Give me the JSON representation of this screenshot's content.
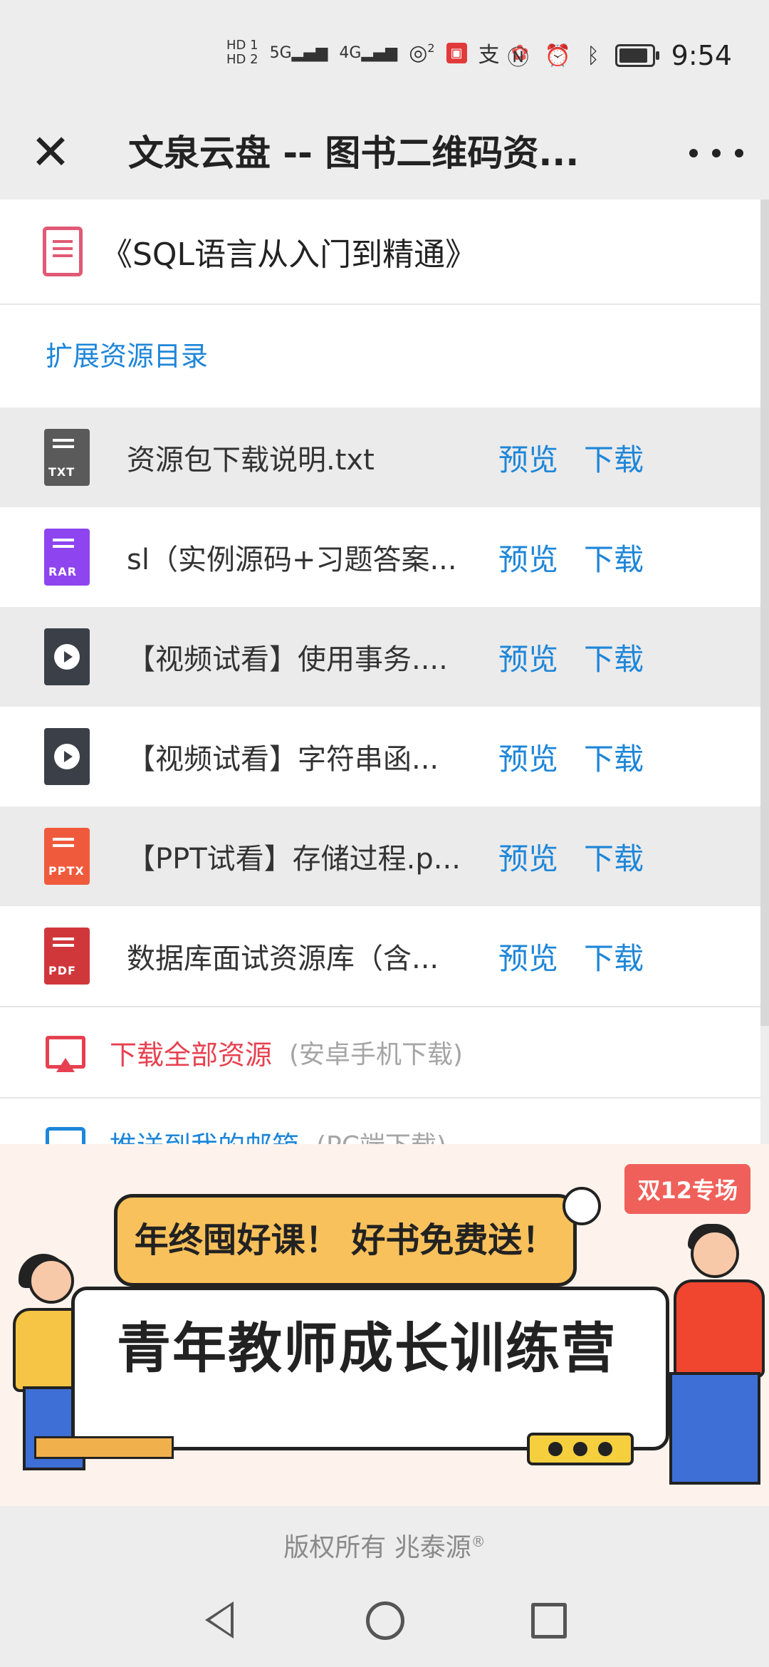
{
  "status_bar": {
    "sim1": "HD 1",
    "sim2": "HD 2",
    "net1": "5G",
    "net2": "4G",
    "wifi_sup": "2",
    "app_icon_zhi": "支",
    "time": "9:54"
  },
  "navbar": {
    "title": "文泉云盘 -- 图书二维码资...",
    "close_icon": "close-icon",
    "more_icon": "more-dots-icon"
  },
  "book": {
    "title": "《SQL语言从入门到精通》",
    "icon": "book-icon"
  },
  "section_title": "扩展资源目录",
  "files": [
    {
      "name": "资源包下载说明.txt",
      "type_tag": "TXT",
      "icon": "txt-file-icon",
      "preview": "预览",
      "download": "下载"
    },
    {
      "name": "sl（实例源码+习题答案...",
      "type_tag": "RAR",
      "icon": "rar-file-icon",
      "preview": "预览",
      "download": "下载"
    },
    {
      "name": "【视频试看】使用事务....",
      "type_tag": "",
      "icon": "video-file-icon",
      "preview": "预览",
      "download": "下载"
    },
    {
      "name": "【视频试看】字符串函...",
      "type_tag": "",
      "icon": "video-file-icon",
      "preview": "预览",
      "download": "下载"
    },
    {
      "name": "【PPT试看】存储过程.p...",
      "type_tag": "PPTX",
      "icon": "pptx-file-icon",
      "preview": "预览",
      "download": "下载"
    },
    {
      "name": "数据库面试资源库（含...",
      "type_tag": "PDF",
      "icon": "pdf-file-icon",
      "preview": "预览",
      "download": "下载"
    }
  ],
  "actions": {
    "download_all": {
      "label": "下载全部资源",
      "note": "(安卓手机下载)",
      "icon": "download-all-icon"
    },
    "push_email": {
      "label": "推送到我的邮箱",
      "note": "(PC端下载)",
      "icon": "push-upload-icon"
    }
  },
  "banner": {
    "badge": "双12专场",
    "bubble_text": "年终囤好课！ 好书免费送！",
    "headline": "青年教师成长训练营"
  },
  "footer": {
    "copyright": "版权所有 兆泰源",
    "reg_mark": "®"
  },
  "colors": {
    "accent_blue": "#1e86d8",
    "accent_red": "#e64150",
    "alt_row_bg": "#ebebeb",
    "page_bg": "#ededed"
  }
}
